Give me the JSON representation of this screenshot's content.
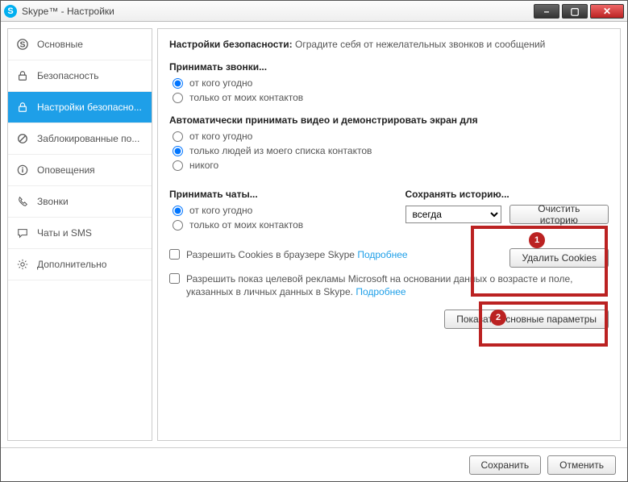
{
  "titlebar": {
    "title": "Skype™ - Настройки"
  },
  "sidebar": {
    "items": [
      {
        "label": "Основные",
        "icon": "skype"
      },
      {
        "label": "Безопасность",
        "icon": "lock"
      },
      {
        "label": "Настройки безопасно...",
        "icon": "lock",
        "selected": true
      },
      {
        "label": "Заблокированные по...",
        "icon": "blocked"
      },
      {
        "label": "Оповещения",
        "icon": "info"
      },
      {
        "label": "Звонки",
        "icon": "phone"
      },
      {
        "label": "Чаты и SMS",
        "icon": "chat"
      },
      {
        "label": "Дополнительно",
        "icon": "gear"
      }
    ]
  },
  "header": {
    "bold": "Настройки безопасности:",
    "rest": "Оградите себя от нежелательных звонков и сообщений"
  },
  "calls": {
    "title": "Принимать звонки...",
    "opt_anyone": "от кого угодно",
    "opt_contacts": "только от моих контактов"
  },
  "video": {
    "title": "Автоматически принимать видео и демонстрировать экран для",
    "opt_anyone": "от кого угодно",
    "opt_contacts": "только людей из моего списка контактов",
    "opt_nobody": "никого"
  },
  "chats": {
    "title": "Принимать чаты...",
    "opt_anyone": "от кого угодно",
    "opt_contacts": "только от моих контактов"
  },
  "history": {
    "title": "Сохранять историю...",
    "select_value": "всегда",
    "clear_btn": "Очистить историю"
  },
  "cookies": {
    "allow_label": "Разрешить Cookies в браузере Skype",
    "more": "Подробнее",
    "delete_btn": "Удалить Cookies",
    "ads_label": "Разрешить показ целевой рекламы Microsoft на основании данных о возрасте и поле, указанных в личных данных в Skype.",
    "ads_more": "Подробнее"
  },
  "show_basic_btn": "Показать основные параметры",
  "footer": {
    "save": "Сохранить",
    "cancel": "Отменить"
  },
  "annotations": {
    "n1": "1",
    "n2": "2"
  }
}
